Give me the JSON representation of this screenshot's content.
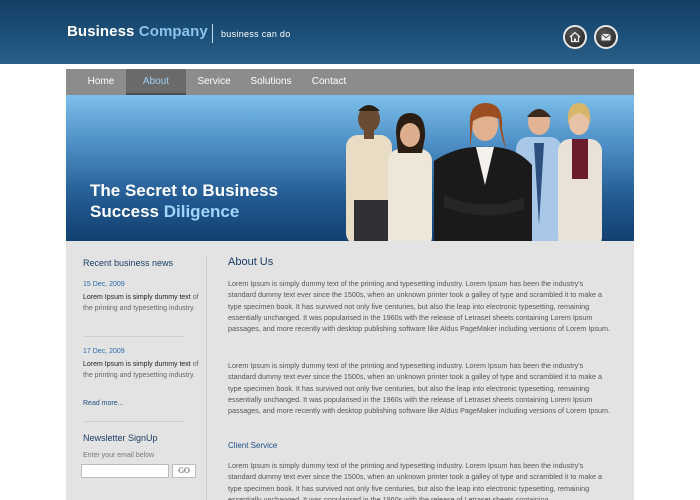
{
  "header": {
    "brand_part1": "Business",
    "brand_part2": "Company",
    "tagline": "business can do",
    "icons": [
      "home-icon",
      "mail-icon"
    ],
    "colors": {
      "header_bg": "#1d5079",
      "brand_accent": "#8cc3ec"
    }
  },
  "nav": {
    "items": [
      {
        "label": "Home"
      },
      {
        "label": "About"
      },
      {
        "label": "Service"
      },
      {
        "label": "Solutions"
      },
      {
        "label": "Contact"
      }
    ],
    "active": "About"
  },
  "hero": {
    "line1": "The Secret to Business",
    "line2_part1": "Success",
    "line2_part2": "Diligence"
  },
  "sidebar": {
    "news_title": "Recent business news",
    "news": [
      {
        "date": "15 Dec, 2009",
        "text_bold": "Lorem Ipsum is simply dummy text",
        "text": "of the printing and typesetting industry."
      },
      {
        "date": "17 Dec, 2009",
        "text_bold": "Lorem Ipsum is simply dummy text",
        "text": "of the printing and typesetting industry."
      }
    ],
    "read_more": "Read more...",
    "newsletter_title": "Newsletter SignUp",
    "email_label": "Enter your email below",
    "email_value": "",
    "go_label": "GO"
  },
  "main": {
    "title": "About Us",
    "para1": "Lorem Ipsum is simply dummy text of the printing and typesetting industry. Lorem Ipsum has been the industry's standard dummy text ever since the 1500s, when an unknown printer took a galley of type and scrambled it to make a type specimen book. It has survived not only five centuries, but also the leap into electronic typesetting, remaining essentially unchanged. It was popularised in the 1960s with the release of Letraset sheets containing Lorem Ipsum passages, and more recently with desktop publishing software like Aldus PageMaker including versions of Lorem Ipsum.",
    "para2": "Lorem Ipsum is simply dummy text of the printing and typesetting industry. Lorem Ipsum has been the industry's standard dummy text ever since the 1500s, when an unknown printer took a galley of type and scrambled it to make a type specimen book. It has survived not only five centuries, but also the leap into electronic typesetting, remaining essentially unchanged. It was popularised in the 1960s with the release of Letraset sheets containing Lorem Ipsum passages, and more recently with desktop publishing software like Aldus PageMaker including versions of Lorem Ipsum.",
    "subtitle": "Client Service",
    "para3": "Lorem Ipsum is simply dummy text of the printing and typesetting industry. Lorem Ipsum has been the industry's standard dummy text ever since the 1500s, when an unknown printer took a galley of type and scrambled it to make a type specimen book. It has survived not only five centuries, but also the leap into electronic typesetting, remaining essentially unchanged. It was popularised in the 1960s with the release of Letraset sheets containing"
  }
}
